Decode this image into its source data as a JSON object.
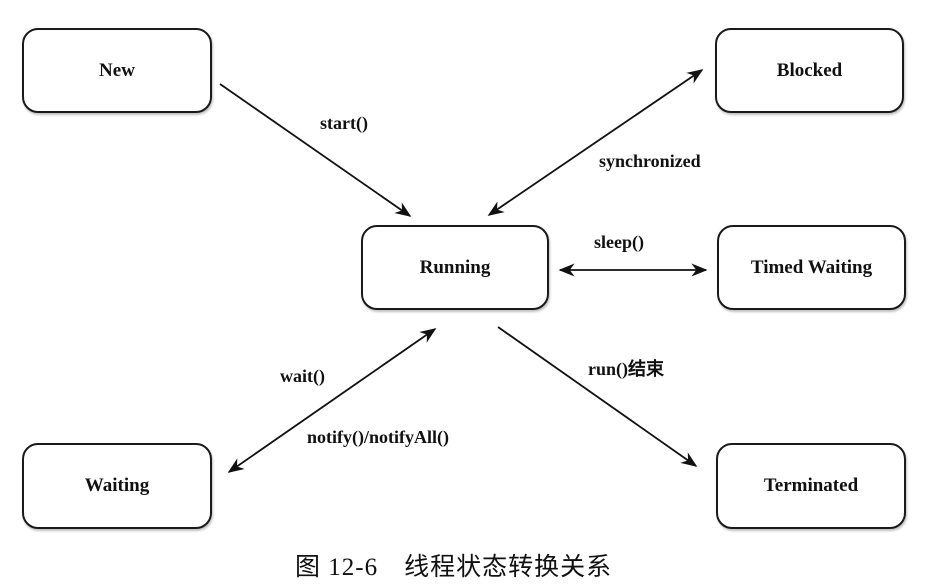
{
  "diagram": {
    "states": {
      "new": "New",
      "blocked": "Blocked",
      "running": "Running",
      "timed_waiting": "Timed Waiting",
      "waiting": "Waiting",
      "terminated": "Terminated"
    },
    "transitions": [
      {
        "from": "New",
        "to": "Running",
        "label": "start()",
        "direction": "one-way"
      },
      {
        "from": "Running",
        "to": "Blocked",
        "label": "synchronized",
        "direction": "two-way"
      },
      {
        "from": "Running",
        "to": "Timed Waiting",
        "label": "sleep()",
        "direction": "two-way"
      },
      {
        "from": "Running",
        "to": "Waiting",
        "label_up": "wait()",
        "label_down": "notify()/notifyAll()",
        "direction": "two-way"
      },
      {
        "from": "Running",
        "to": "Terminated",
        "label": "run()结束",
        "direction": "one-way"
      }
    ]
  },
  "labels": {
    "start": "start()",
    "synchronized": "synchronized",
    "sleep": "sleep()",
    "wait": "wait()",
    "notify": "notify()/notifyAll()",
    "run_end": "run()结束"
  },
  "caption": {
    "figure_number": "图 12-6",
    "title": "线程状态转换关系"
  }
}
